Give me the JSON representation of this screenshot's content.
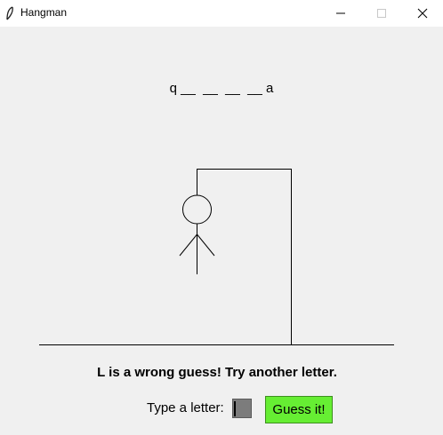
{
  "window": {
    "title": "Hangman",
    "app_icon": "feather-icon",
    "controls": [
      "minimize-icon",
      "maximize-icon",
      "close-icon"
    ]
  },
  "game": {
    "word_display": "q __  __  __  __ a",
    "message": "L is a wrong guess! Try another letter.",
    "input_label": "Type a letter:",
    "input_value": "",
    "guess_button_label": "Guess it!"
  },
  "colors": {
    "window_bg": "#f0f0f0",
    "titlebar_bg": "#ffffff",
    "button_bg": "#66ee33",
    "input_bg": "#7c7c7c"
  }
}
